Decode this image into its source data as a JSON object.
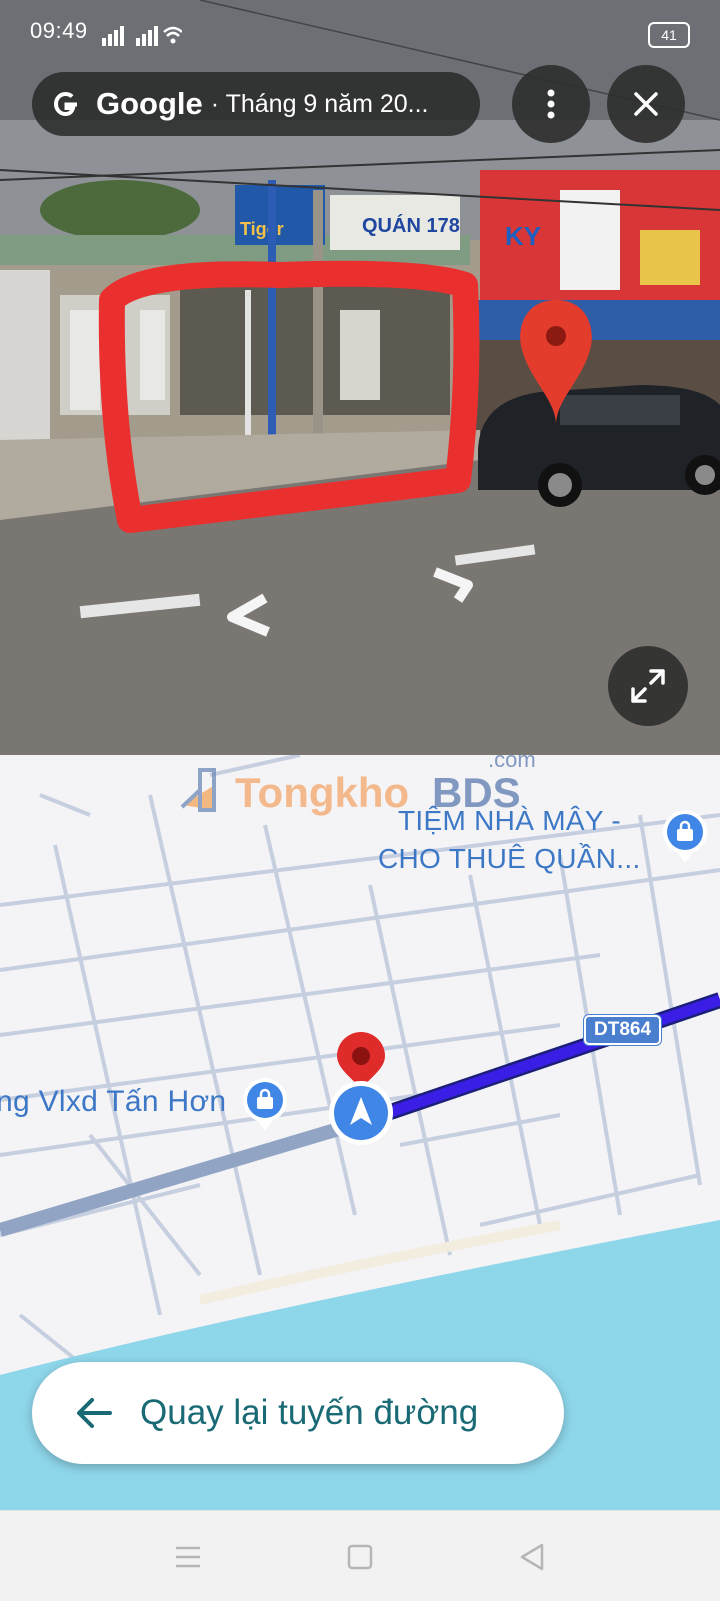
{
  "status_bar": {
    "time": "09:49",
    "battery": "41"
  },
  "streetview": {
    "brand": "Google",
    "date": "· Tháng 9 năm 20...",
    "signs": {
      "shop": "QUÁN 178",
      "other": "Tiger",
      "banner": "KY"
    }
  },
  "map": {
    "watermark_left": "Tongkho",
    "watermark_right": "BDS",
    "watermark_com": ".com",
    "poi_top_line1": "TIỆM NHÀ MÂY -",
    "poi_top_line2": "CHO THUÊ QUẦN...",
    "poi_left": "ng Vlxd Tấn Hơn",
    "road_label": "DT864"
  },
  "actions": {
    "back_to_route": "Quay lại tuyến đường"
  },
  "icons": [
    "google-g-icon",
    "more-vert-icon",
    "close-icon",
    "expand-icon",
    "shopping-bag-icon",
    "location-pin-icon",
    "navigation-arrow-icon",
    "back-arrow-icon",
    "recents-icon",
    "home-icon",
    "back-icon"
  ],
  "colors": {
    "route": "#3b1ee6",
    "water": "#8ed6ea",
    "accent_text": "#196a74",
    "poi": "#3d78c7",
    "pin": "#e02b2b"
  }
}
